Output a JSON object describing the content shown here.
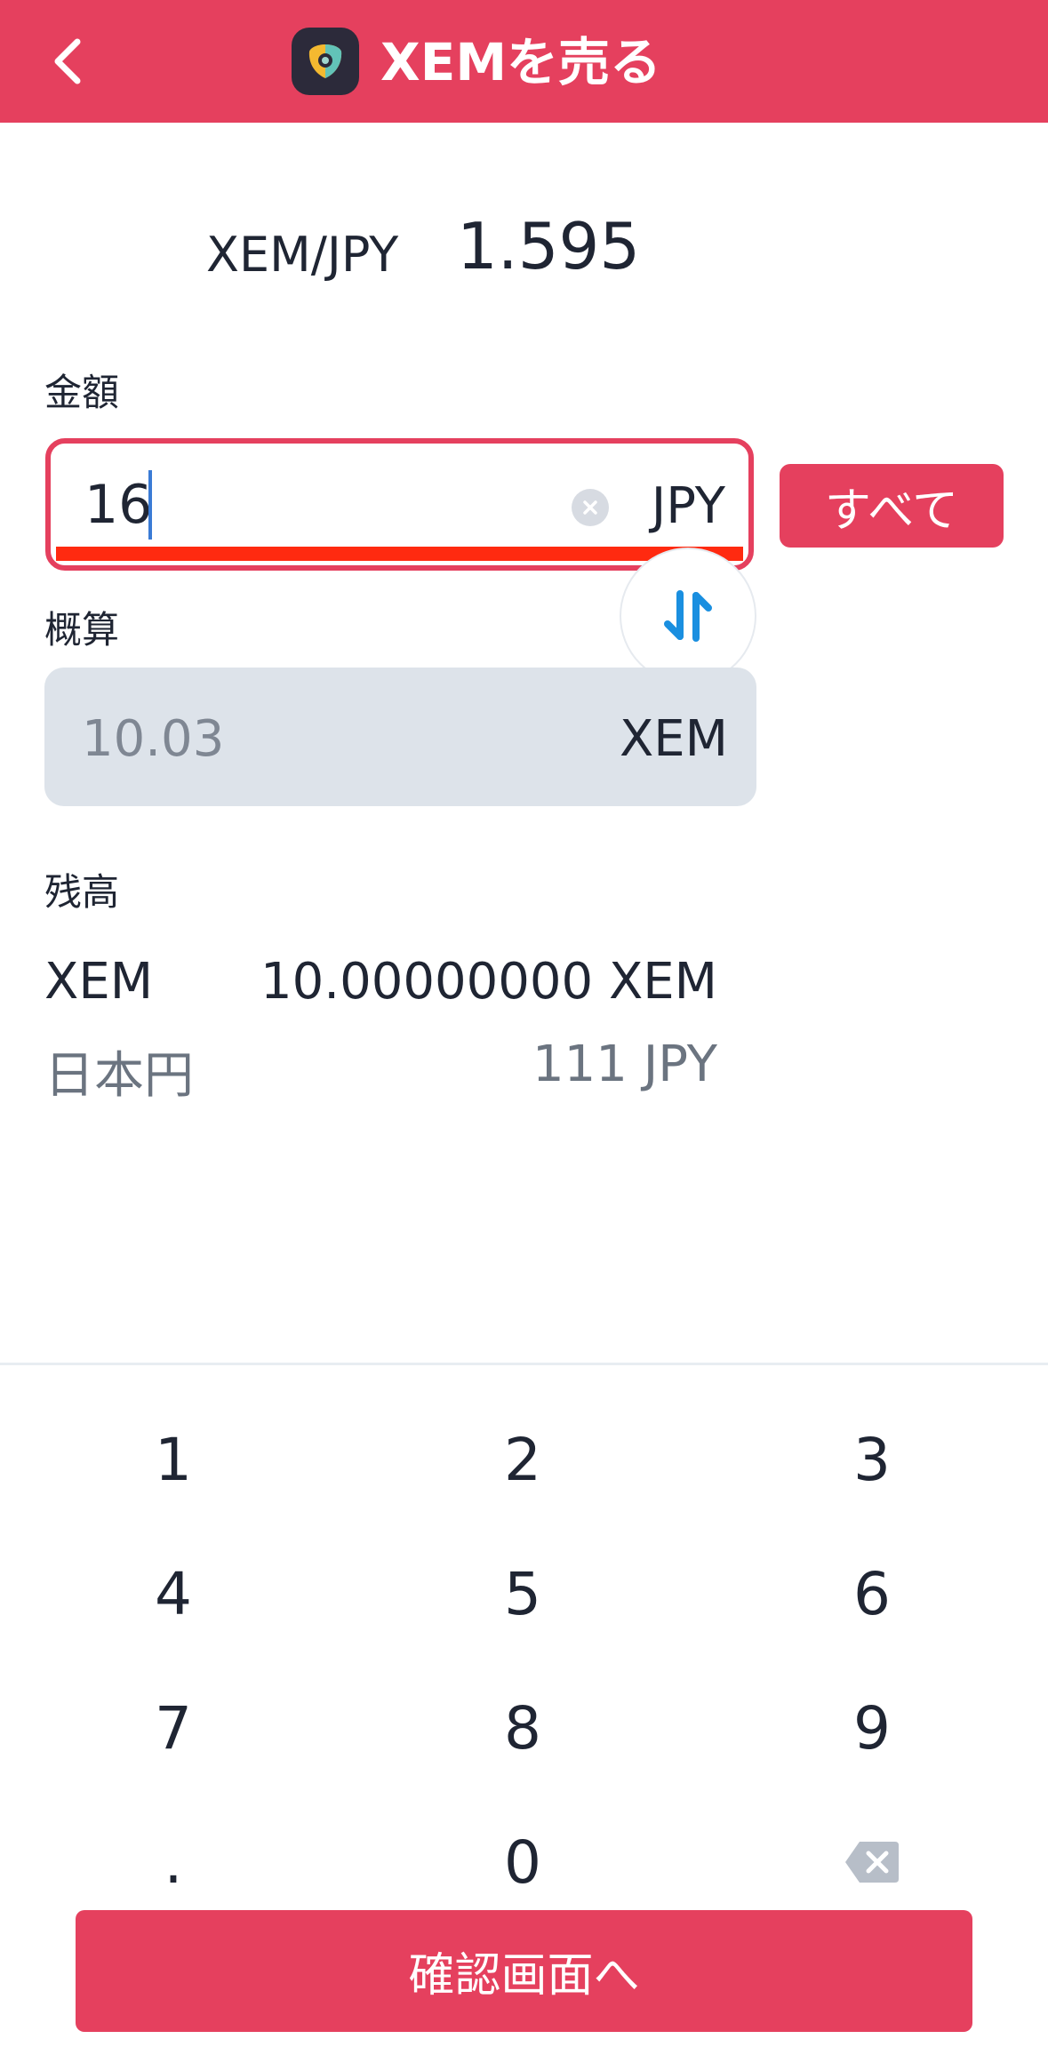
{
  "header": {
    "title": "XEMを売る",
    "back_icon": "chevron-left-icon",
    "logo_icon": "nem-logo-icon",
    "color": "#e5405e"
  },
  "rate": {
    "pair": "XEM/JPY",
    "value": "1.595"
  },
  "amount": {
    "label": "金額",
    "value": "16",
    "unit": "JPY",
    "clear_icon": "clear-icon",
    "all_button": "すべて"
  },
  "swap": {
    "icon": "swap-arrows-icon",
    "color": "#1a8fe0"
  },
  "approx": {
    "label": "概算",
    "value": "10.03",
    "unit": "XEM"
  },
  "balance": {
    "label": "残高",
    "rows": [
      {
        "name": "XEM",
        "amount": "10.00000000 XEM"
      },
      {
        "name": "日本円",
        "amount": "111 JPY"
      }
    ]
  },
  "keypad": {
    "keys": [
      "1",
      "2",
      "3",
      "4",
      "5",
      "6",
      "7",
      "8",
      "9",
      ".",
      "0"
    ],
    "backspace_icon": "backspace-icon"
  },
  "confirm": {
    "label": "確認画面へ"
  }
}
